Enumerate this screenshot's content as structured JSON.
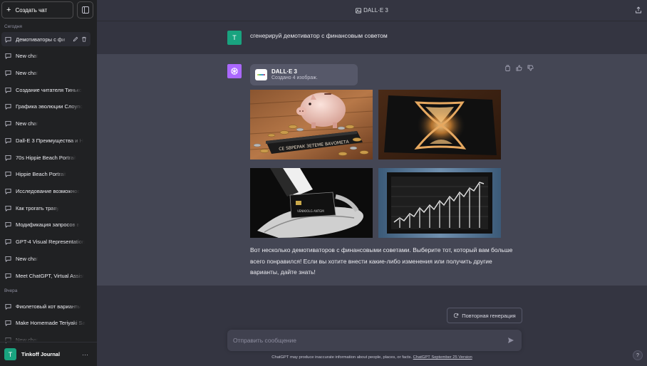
{
  "sidebar": {
    "new_chat_label": "Создать чат",
    "sections": [
      {
        "label": "Сегодня",
        "items": [
          {
            "label": "Демотиваторы с фи",
            "active": true
          },
          {
            "label": "New chat"
          },
          {
            "label": "New chat"
          },
          {
            "label": "Создание читателя Тинько"
          },
          {
            "label": "Графика эволюции Слоупо"
          },
          {
            "label": "New chat"
          },
          {
            "label": "Dall-E 3 Преимущества и Н"
          },
          {
            "label": "70s Hippie Beach Portrait"
          },
          {
            "label": "Hippie Beach Portrait"
          },
          {
            "label": "Исследование возможнос"
          },
          {
            "label": "Как трогать траву"
          },
          {
            "label": "Модификация запросов в"
          },
          {
            "label": "GPT-4 Visual Representation"
          },
          {
            "label": "New chat"
          },
          {
            "label": "Meet ChatGPT, Virtual Assist"
          }
        ]
      },
      {
        "label": "Вчера",
        "items": [
          {
            "label": "Фиолетовый кот варианты"
          },
          {
            "label": "Make Homemade Teriyaki Sa"
          },
          {
            "label": "New chat"
          }
        ]
      }
    ],
    "user": {
      "avatar_letter": "T",
      "name": "Tinkoff Journal",
      "menu": "···"
    }
  },
  "header": {
    "title": "DALL·E 3"
  },
  "conversation": {
    "user_avatar": "T",
    "user_message": "сгенерируй демотиватор с финансовым советом",
    "tool_card": {
      "title": "DALL·E 3",
      "subtitle": "Создано 4 изображ."
    },
    "images": [
      {
        "alt": "piggy-bank-coins"
      },
      {
        "alt": "hourglass"
      },
      {
        "alt": "hand-holding-card"
      },
      {
        "alt": "stock-chart-frame"
      }
    ],
    "image_plaque_text": "СЕ SВРЕРАК ЗЕТЕМЕ ВАVОМЕТА",
    "card_text": "VЕNIKIOLG ANTGM",
    "assistant_message": "Вот несколько демотиваторов с финансовыми советами. Выберите тот, который вам больше всего понравился! Если вы хотите внести какие-либо изменения или получить другие варианты, дайте знать!"
  },
  "regenerate_label": "Повторная генерация",
  "composer": {
    "placeholder": "Отправить сообщение"
  },
  "disclaimer": {
    "text": "ChatGPT may produce inaccurate information about people, places, or facts. ",
    "link": "ChatGPT September 25 Version"
  },
  "help_label": "?",
  "colors": {
    "sidebar_bg": "#202123",
    "main_bg": "#343541",
    "assistant_bg": "#444654",
    "user_avatar": "#19a37f",
    "assistant_avatar": "#ab68ff"
  }
}
